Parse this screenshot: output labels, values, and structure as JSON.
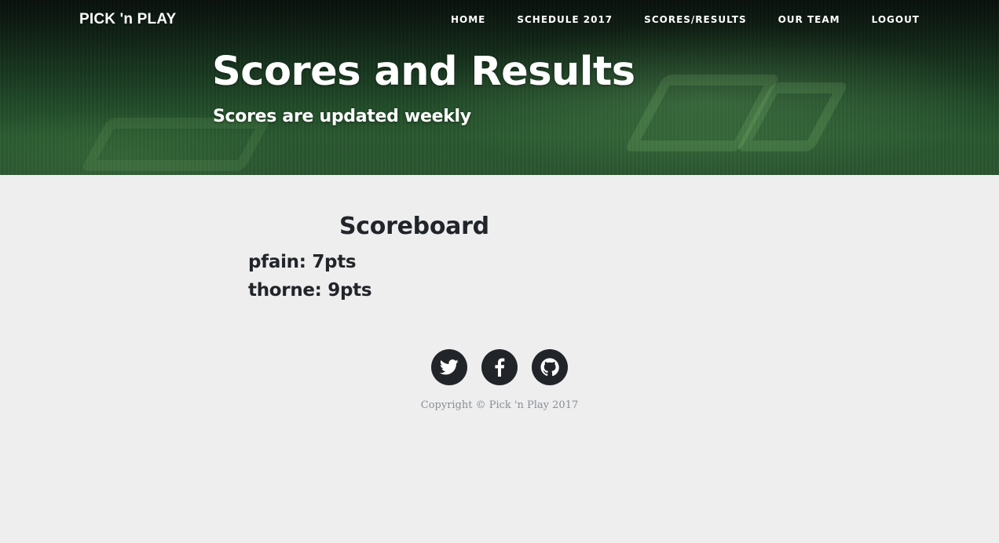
{
  "navbar": {
    "brand": "PICK 'n PLAY",
    "items": [
      {
        "label": "HOME"
      },
      {
        "label": "SCHEDULE 2017"
      },
      {
        "label": "SCORES/RESULTS"
      },
      {
        "label": "OUR TEAM"
      },
      {
        "label": "LOGOUT"
      }
    ]
  },
  "hero": {
    "title": "Scores and Results",
    "subtitle": "Scores are updated weekly"
  },
  "scoreboard": {
    "title": "Scoreboard",
    "entries": [
      {
        "text": "pfain: 7pts"
      },
      {
        "text": "thorne: 9pts"
      }
    ]
  },
  "footer": {
    "social": [
      {
        "icon": "twitter-icon"
      },
      {
        "icon": "facebook-icon"
      },
      {
        "icon": "github-icon"
      }
    ],
    "copyright": "Copyright © Pick 'n Play 2017"
  },
  "colors": {
    "page_background": "#eeeeee",
    "text_dark": "#212529",
    "text_muted": "#868e96",
    "nav_text": "#ffffff"
  }
}
